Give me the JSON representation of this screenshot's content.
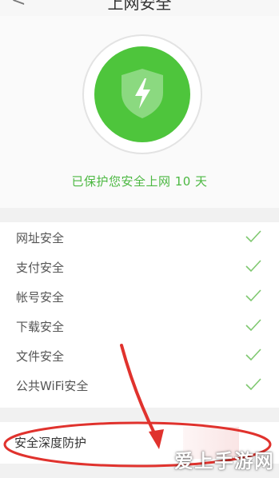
{
  "header": {
    "title": "上网安全",
    "back_icon": "back-arrow-icon"
  },
  "hero": {
    "status_text": "已保护您安全上网 10 天",
    "accent_color": "#4ec53c",
    "icon": "shield-lightning-icon"
  },
  "security_items": [
    {
      "label": "网址安全",
      "status_icon": "check-icon"
    },
    {
      "label": "支付安全",
      "status_icon": "check-icon"
    },
    {
      "label": "帐号安全",
      "status_icon": "check-icon"
    },
    {
      "label": "下载安全",
      "status_icon": "check-icon"
    },
    {
      "label": "文件安全",
      "status_icon": "check-icon"
    },
    {
      "label": "公共WiFi安全",
      "status_icon": "check-icon"
    }
  ],
  "deep_protection": {
    "label": "安全深度防护"
  },
  "annotation": {
    "color": "#e0322d"
  },
  "watermark": {
    "text": "爱上手游网"
  }
}
